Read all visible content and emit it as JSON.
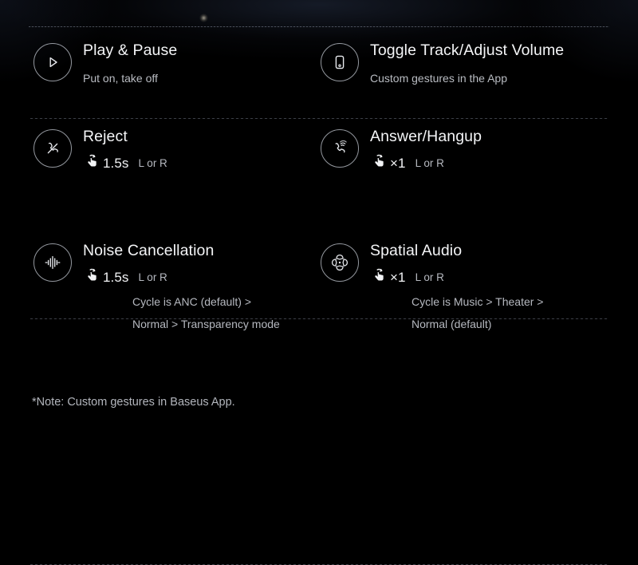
{
  "page": {
    "background_color": "#000000",
    "title_color": "#f4f5f7",
    "subtitle_color": "#b9bcc2"
  },
  "features": [
    {
      "icon": "play-pause-icon",
      "title": "Play & Pause",
      "subtitle": "Put on, take off"
    },
    {
      "icon": "phone-device-icon",
      "title": "Toggle Track/Adjust Volume",
      "subtitle": "Custom gestures in the App"
    },
    {
      "icon": "reject-call-icon",
      "title": "Reject",
      "gesture_icon": "tap-hold-icon",
      "gesture_amount": "1.5s",
      "gesture_side": "L or R"
    },
    {
      "icon": "answer-call-icon",
      "title": "Answer/Hangup",
      "gesture_icon": "tap-hold-icon",
      "gesture_amount": "×1",
      "gesture_side": "L or R"
    },
    {
      "icon": "noise-cancellation-icon",
      "title": "Noise Cancellation",
      "gesture_icon": "tap-hold-icon",
      "gesture_amount": "1.5s",
      "gesture_side": "L or R",
      "cycle_line_1": "Cycle is ANC (default) >",
      "cycle_line_2": "Normal > Transparency mode"
    },
    {
      "icon": "spatial-audio-icon",
      "title": "Spatial Audio",
      "gesture_icon": "tap-hold-icon",
      "gesture_amount": "×1",
      "gesture_side": "L or R",
      "cycle_line_1": "Cycle is Music > Theater >",
      "cycle_line_2": "Normal (default)"
    }
  ],
  "footer": {
    "note": "*Note: Custom gestures in Baseus App."
  }
}
